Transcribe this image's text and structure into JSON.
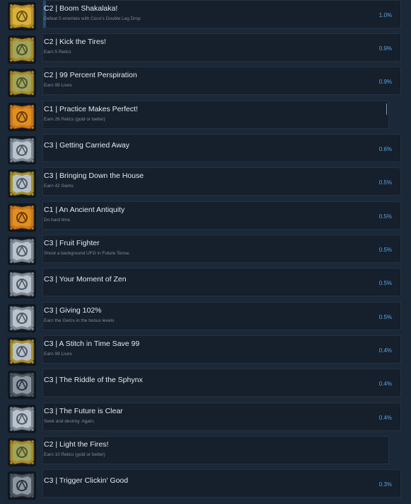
{
  "achievements": [
    {
      "title": "C2 | Boom Shakalaka!",
      "desc": "Defeat 5 enemies with Coco's Double Leg Drop",
      "pct": "1.0%",
      "tier": "gold",
      "icon": "trophy-emblem-icon"
    },
    {
      "title": "C2 | Kick the Tires!",
      "desc": "Earn 5 Relics",
      "pct": "0.9%",
      "tier": "goldgreen",
      "icon": "ankh-emblem-icon"
    },
    {
      "title": "C2 | 99 Percent Perspiration",
      "desc": "Earn 99 Lives",
      "pct": "0.9%",
      "tier": "goldgreen",
      "icon": "mask-emblem-icon"
    },
    {
      "title": "C1 | Practice Makes Perfect!",
      "desc": "Earn 26 Relics (gold or better)",
      "pct": "",
      "tier": "orange",
      "icon": "totem-emblem-icon"
    },
    {
      "title": "C3 | Getting Carried Away",
      "desc": "",
      "pct": "0.6%",
      "tier": "silver",
      "icon": "crate-emblem-icon"
    },
    {
      "title": "C3 | Bringing Down the House",
      "desc": "Earn 42 Gems",
      "pct": "0.5%",
      "tier": "silvergold",
      "icon": "gem-emblem-icon"
    },
    {
      "title": "C1 | An Ancient Antiquity",
      "desc": "Do hard time",
      "pct": "0.5%",
      "tier": "orange",
      "icon": "spiral-emblem-icon"
    },
    {
      "title": "C3 | Fruit Fighter",
      "desc": "Shoot a background UFO in Future Tense.",
      "pct": "0.5%",
      "tier": "silver",
      "icon": "ufo-emblem-icon"
    },
    {
      "title": "C3 | Your Moment of Zen",
      "desc": "",
      "pct": "0.5%",
      "tier": "silver",
      "icon": "zen-emblem-icon"
    },
    {
      "title": "C3 | Giving 102%",
      "desc": "Earn the Gems in the bonus levels",
      "pct": "0.5%",
      "tier": "silver",
      "icon": "crown-emblem-icon"
    },
    {
      "title": "C3 | A Stitch in Time Save 99",
      "desc": "Earn 99 Lives",
      "pct": "0.4%",
      "tier": "silvergold",
      "icon": "mask-emblem-icon"
    },
    {
      "title": "C3 | The Riddle of the Sphynx",
      "desc": "",
      "pct": "0.4%",
      "tier": "silverdark",
      "icon": "sphynx-emblem-icon"
    },
    {
      "title": "C3 | The Future is Clear",
      "desc": "Seek and destroy. Again.",
      "pct": "0.4%",
      "tier": "silver",
      "icon": "robot-emblem-icon"
    },
    {
      "title": "C2 | Light the Fires!",
      "desc": "Earn 10 Relics (gold or better)",
      "pct": "",
      "tier": "goldgreen",
      "icon": "flame-emblem-icon"
    },
    {
      "title": "C3 | Trigger Clickin' Good",
      "desc": "",
      "pct": "0.3%",
      "tier": "silverdark",
      "icon": "gun-emblem-icon"
    }
  ],
  "colors": {
    "background": "#1b2838",
    "panel": "#16202d",
    "percent": "#5aa3de",
    "title": "#e2e8ef",
    "desc": "#7e8b98"
  }
}
